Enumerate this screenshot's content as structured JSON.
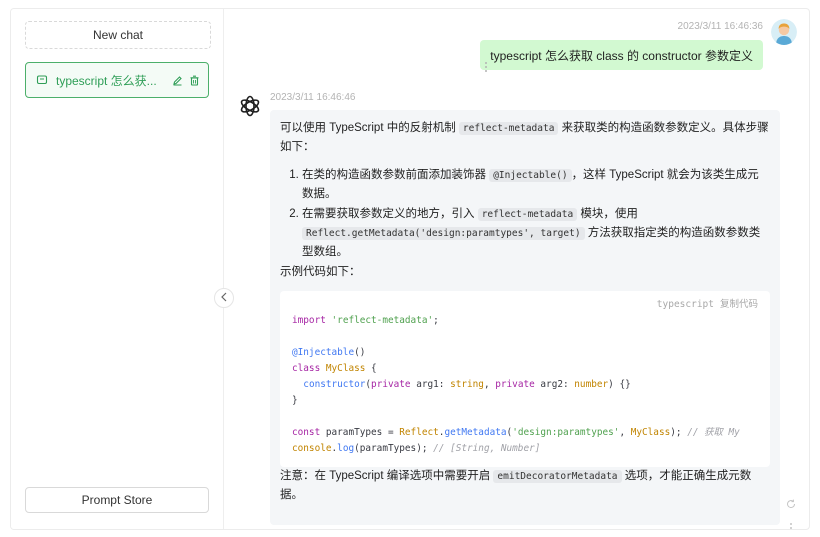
{
  "sidebar": {
    "new_chat_label": "New chat",
    "chat_items": [
      {
        "title": "typescript 怎么获..."
      }
    ],
    "prompt_store_label": "Prompt Store"
  },
  "conversation": {
    "user_message": {
      "timestamp": "2023/3/11 16:46:36",
      "text": "typescript 怎么获取 class 的 constructor 参数定义"
    },
    "bot_message": {
      "timestamp": "2023/3/11 16:46:46",
      "intro_before": "可以使用 TypeScript 中的反射机制 ",
      "intro_code": "reflect-metadata",
      "intro_after": " 来获取类的构造函数参数定义。具体步骤如下：",
      "step1_before": "在类的构造函数参数前面添加装饰器 ",
      "step1_code": "@Injectable()",
      "step1_after": "，这样 TypeScript 就会为该类生成元数据。",
      "step2_before": "在需要获取参数定义的地方，引入 ",
      "step2_code1": "reflect-metadata",
      "step2_mid": " 模块，使用 ",
      "step2_code2": "Reflect.getMetadata('design:paramtypes', target)",
      "step2_after": " 方法获取指定类的构造函数参数类型数组。",
      "example_label": "示例代码如下：",
      "code_lang": "typescript",
      "code_copy": "复制代码",
      "code": {
        "l1_kw": "import",
        "l1_str": "'reflect-metadata'",
        "l1_end": ";",
        "l3_dec": "@Injectable",
        "l3_end": "()",
        "l4_kw": "class",
        "l4_cls": "MyClass",
        "l4_end": " {",
        "l5_fn": "constructor",
        "l5_p1": "(",
        "l5_kw1": "private",
        "l5_a1": " arg1: ",
        "l5_t1": "string",
        "l5_c": ", ",
        "l5_kw2": "private",
        "l5_a2": " arg2: ",
        "l5_t2": "number",
        "l5_end": ") {}",
        "l6": "}",
        "l8_kw": "const",
        "l8_a": " paramTypes = ",
        "l8_cls": "Reflect",
        "l8_dot": ".",
        "l8_fn": "getMetadata",
        "l8_p": "(",
        "l8_str": "'design:paramtypes'",
        "l8_c": ", ",
        "l8_cls2": "MyClass",
        "l8_end": "); ",
        "l8_cm": "// 获取 My",
        "l9_cls": "console",
        "l9_dot": ".",
        "l9_fn": "log",
        "l9_a": "(paramTypes); ",
        "l9_cm": "// [String, Number]"
      },
      "note_before": "注意：在 TypeScript 编译选项中需要开启 ",
      "note_code": "emitDecoratorMetadata",
      "note_after": " 选项，才能正确生成元数据。"
    }
  },
  "colors": {
    "accent_green": "#4caf6a",
    "user_bubble": "#d2f9d1",
    "bot_bubble": "#f4f6f8"
  },
  "icons": [
    "chat-bubble-icon",
    "edit-icon",
    "delete-icon",
    "chevron-left-icon",
    "user-avatar",
    "openai-logo-icon",
    "more-icon",
    "regenerate-icon"
  ]
}
